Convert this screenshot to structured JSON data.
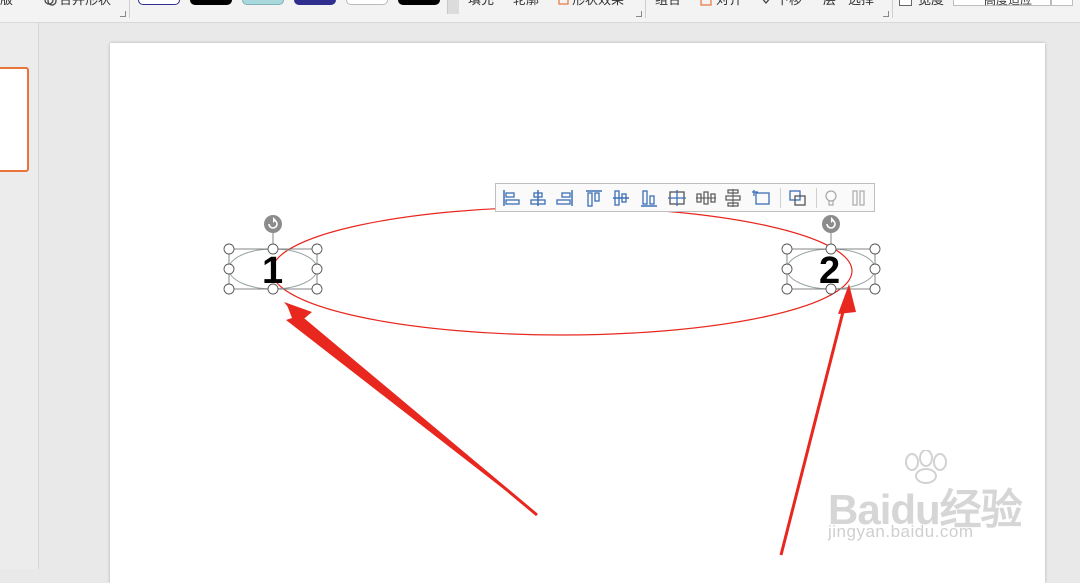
{
  "ribbon": {
    "cut_left": "版",
    "merge_shapes": "合并形状",
    "fill": "填充",
    "outline": "轮廓",
    "shape_effects": "形状效果",
    "group": "组合",
    "align": "对齐",
    "bring_forward": "下移",
    "layer": "一层",
    "select": "选择",
    "size_label": "宽度",
    "combo_value": "高度适应",
    "swatches": [
      "#ffffff",
      "#000000",
      "#a8d8dc",
      "#2e2f8f",
      "#ffffff",
      "#000000"
    ],
    "swatch_borders": [
      "#2e2f8f",
      "#000000",
      "#7fb3b8",
      "#2e2f8f",
      "#bbbbbb",
      "#000000"
    ]
  },
  "slide": {
    "shape1_label": "1",
    "shape2_label": "2"
  },
  "annotation": {
    "color": "#e8271f"
  },
  "align_toolbar": {
    "icons": [
      "align-left-icon",
      "align-center-icon",
      "align-right-icon",
      "align-top-icon",
      "align-middle-icon",
      "align-bottom-icon",
      "distribute-center-icon",
      "distribute-horizontal-icon",
      "distribute-vertical-icon",
      "align-to-slide-icon",
      "group-icon",
      "bulb-icon",
      "collapse-icon"
    ]
  },
  "watermark": {
    "logo": "Baidu经验",
    "sub": "jingyan.baidu.com"
  }
}
